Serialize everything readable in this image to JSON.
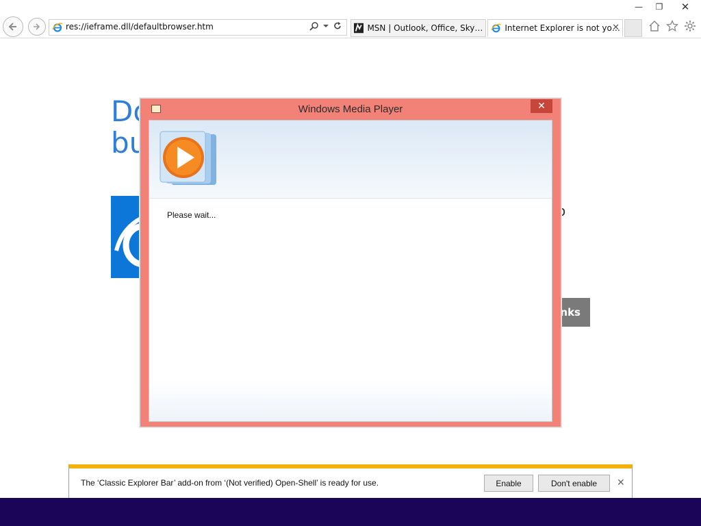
{
  "browser": {
    "address": "res://ieframe.dll/defaultbrowser.htm",
    "tabs": [
      {
        "label": "MSN | Outlook, Office, Skype, ..."
      },
      {
        "label": "Internet Explorer is not your...",
        "close": "✕"
      }
    ],
    "window_controls": {
      "minimize": "—",
      "restore": "❐",
      "close": "✕"
    }
  },
  "page": {
    "heading_line1": "Do",
    "heading_line2": "bu",
    "fragment": "o",
    "button": "anks"
  },
  "dialog": {
    "title": "Windows Media Player",
    "close": "✕",
    "status": "Please wait..."
  },
  "notification": {
    "message": "The ‘Classic Explorer Bar’ add-on from ‘(Not verified) Open-Shell’ is ready for use.",
    "enable_label": "Enable",
    "dont_enable_label": "Don't enable",
    "close": "✕"
  },
  "colors": {
    "dialog_frame": "#f28277",
    "notification_accent": "#f5b10b",
    "taskbar": "#1b0559",
    "ie_blue": "#0c76d9"
  },
  "icons": [
    "back-arrow-icon",
    "forward-arrow-icon",
    "ie-logo-icon",
    "search-icon",
    "dropdown-icon",
    "refresh-icon",
    "msn-icon",
    "home-icon",
    "favorites-star-icon",
    "settings-gear-icon",
    "wmp-logo-icon"
  ]
}
